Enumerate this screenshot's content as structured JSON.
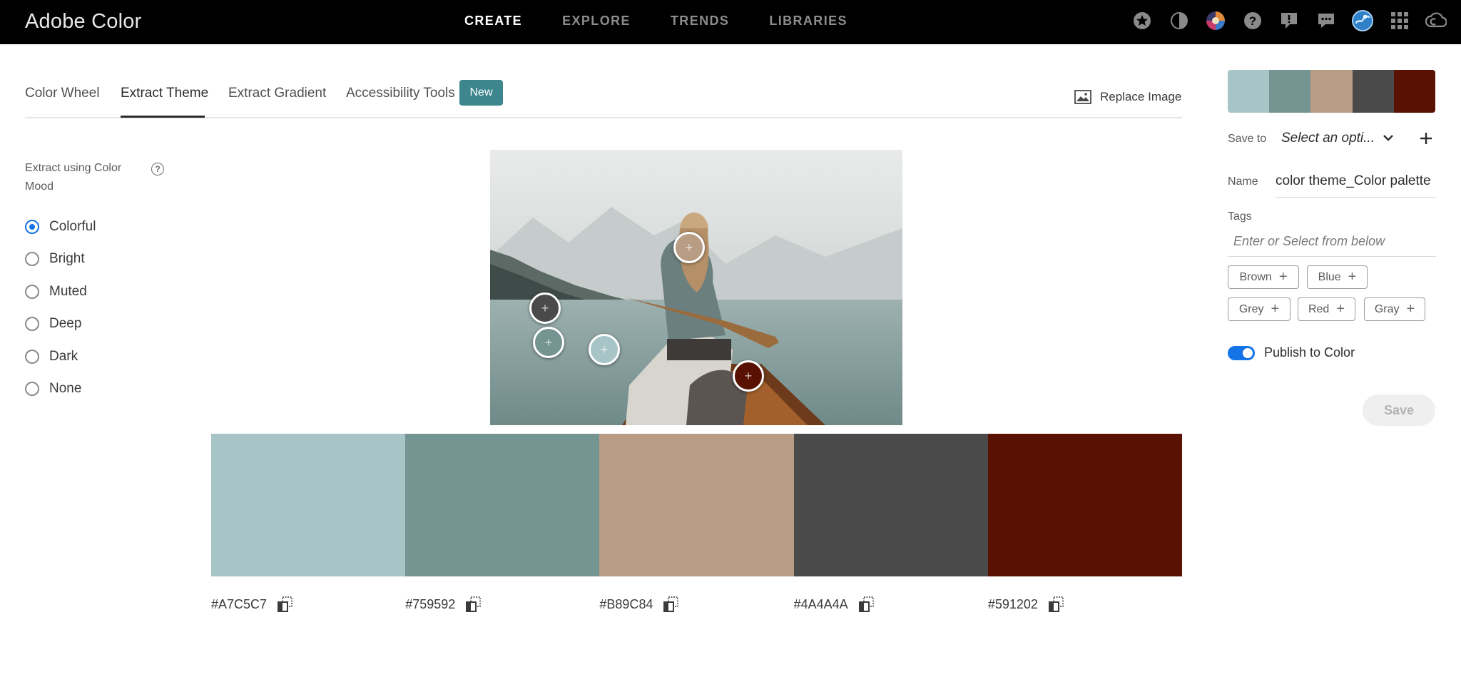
{
  "app": {
    "title": "Adobe Color"
  },
  "topnav": [
    {
      "label": "CREATE",
      "active": true
    },
    {
      "label": "EXPLORE",
      "active": false
    },
    {
      "label": "TRENDS",
      "active": false
    },
    {
      "label": "LIBRARIES",
      "active": false
    }
  ],
  "header_icons": [
    "star-badge-icon",
    "contrast-icon",
    "color-gallery-icon",
    "help-icon",
    "feedback-icon",
    "chat-icon",
    "avatar",
    "apps-grid-icon",
    "creative-cloud-icon"
  ],
  "tabs": [
    {
      "label": "Color Wheel",
      "active": false
    },
    {
      "label": "Extract Theme",
      "active": true
    },
    {
      "label": "Extract Gradient",
      "active": false
    },
    {
      "label": "Accessibility Tools",
      "active": false
    }
  ],
  "new_badge": "New",
  "replace_image": "Replace Image",
  "mood": {
    "title": "Extract using Color Mood",
    "help": "?",
    "options": [
      "Colorful",
      "Bright",
      "Muted",
      "Deep",
      "Dark",
      "None"
    ],
    "selected": "Colorful"
  },
  "palette": [
    {
      "hex": "#A7C5C7",
      "color": "#A7C5C7"
    },
    {
      "hex": "#759592",
      "color": "#759592"
    },
    {
      "hex": "#B89C84",
      "color": "#B89C84"
    },
    {
      "hex": "#4A4A4A",
      "color": "#4A4A4A"
    },
    {
      "hex": "#591202",
      "color": "#591202"
    }
  ],
  "right_panel": {
    "save_to_label": "Save to",
    "save_to_value": "Select an opti...",
    "name_label": "Name",
    "name_value": "color theme_Color palette",
    "tags_label": "Tags",
    "tags_placeholder": "Enter or Select from below",
    "tags": [
      "Brown",
      "Blue",
      "Grey",
      "Red",
      "Gray"
    ],
    "publish_label": "Publish to Color",
    "publish_on": true,
    "save_label": "Save"
  }
}
